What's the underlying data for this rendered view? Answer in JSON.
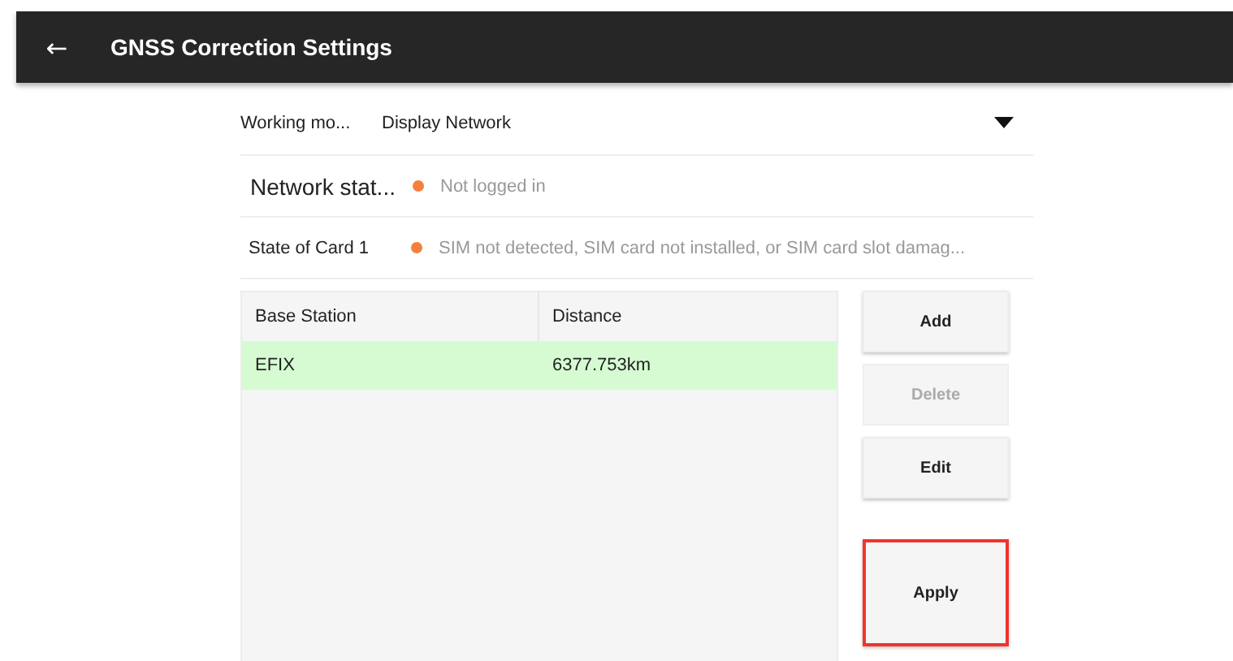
{
  "header": {
    "back_icon": "←",
    "title": "GNSS Correction Settings"
  },
  "settings": [
    {
      "kind": "dropdown",
      "label": "Working mo...",
      "value": "Display Network"
    },
    {
      "kind": "status",
      "label": "Network stat...",
      "value": "Not logged in",
      "color": "#f5803e"
    },
    {
      "kind": "status",
      "label": "State of Card 1",
      "value": "SIM not detected, SIM card not installed, or SIM card slot damag...",
      "color": "#f5803e"
    }
  ],
  "table": {
    "columns": [
      "Base Station",
      "Distance"
    ],
    "rows": [
      {
        "cells": [
          "EFIX",
          "6377.753km"
        ],
        "selected": true
      }
    ]
  },
  "buttons": [
    {
      "label": "Add",
      "disabled": false,
      "highlighted": false
    },
    {
      "label": "Delete",
      "disabled": true,
      "highlighted": false
    },
    {
      "label": "Edit",
      "disabled": false,
      "highlighted": false
    },
    {
      "label": "Apply",
      "disabled": false,
      "highlighted": true
    }
  ]
}
